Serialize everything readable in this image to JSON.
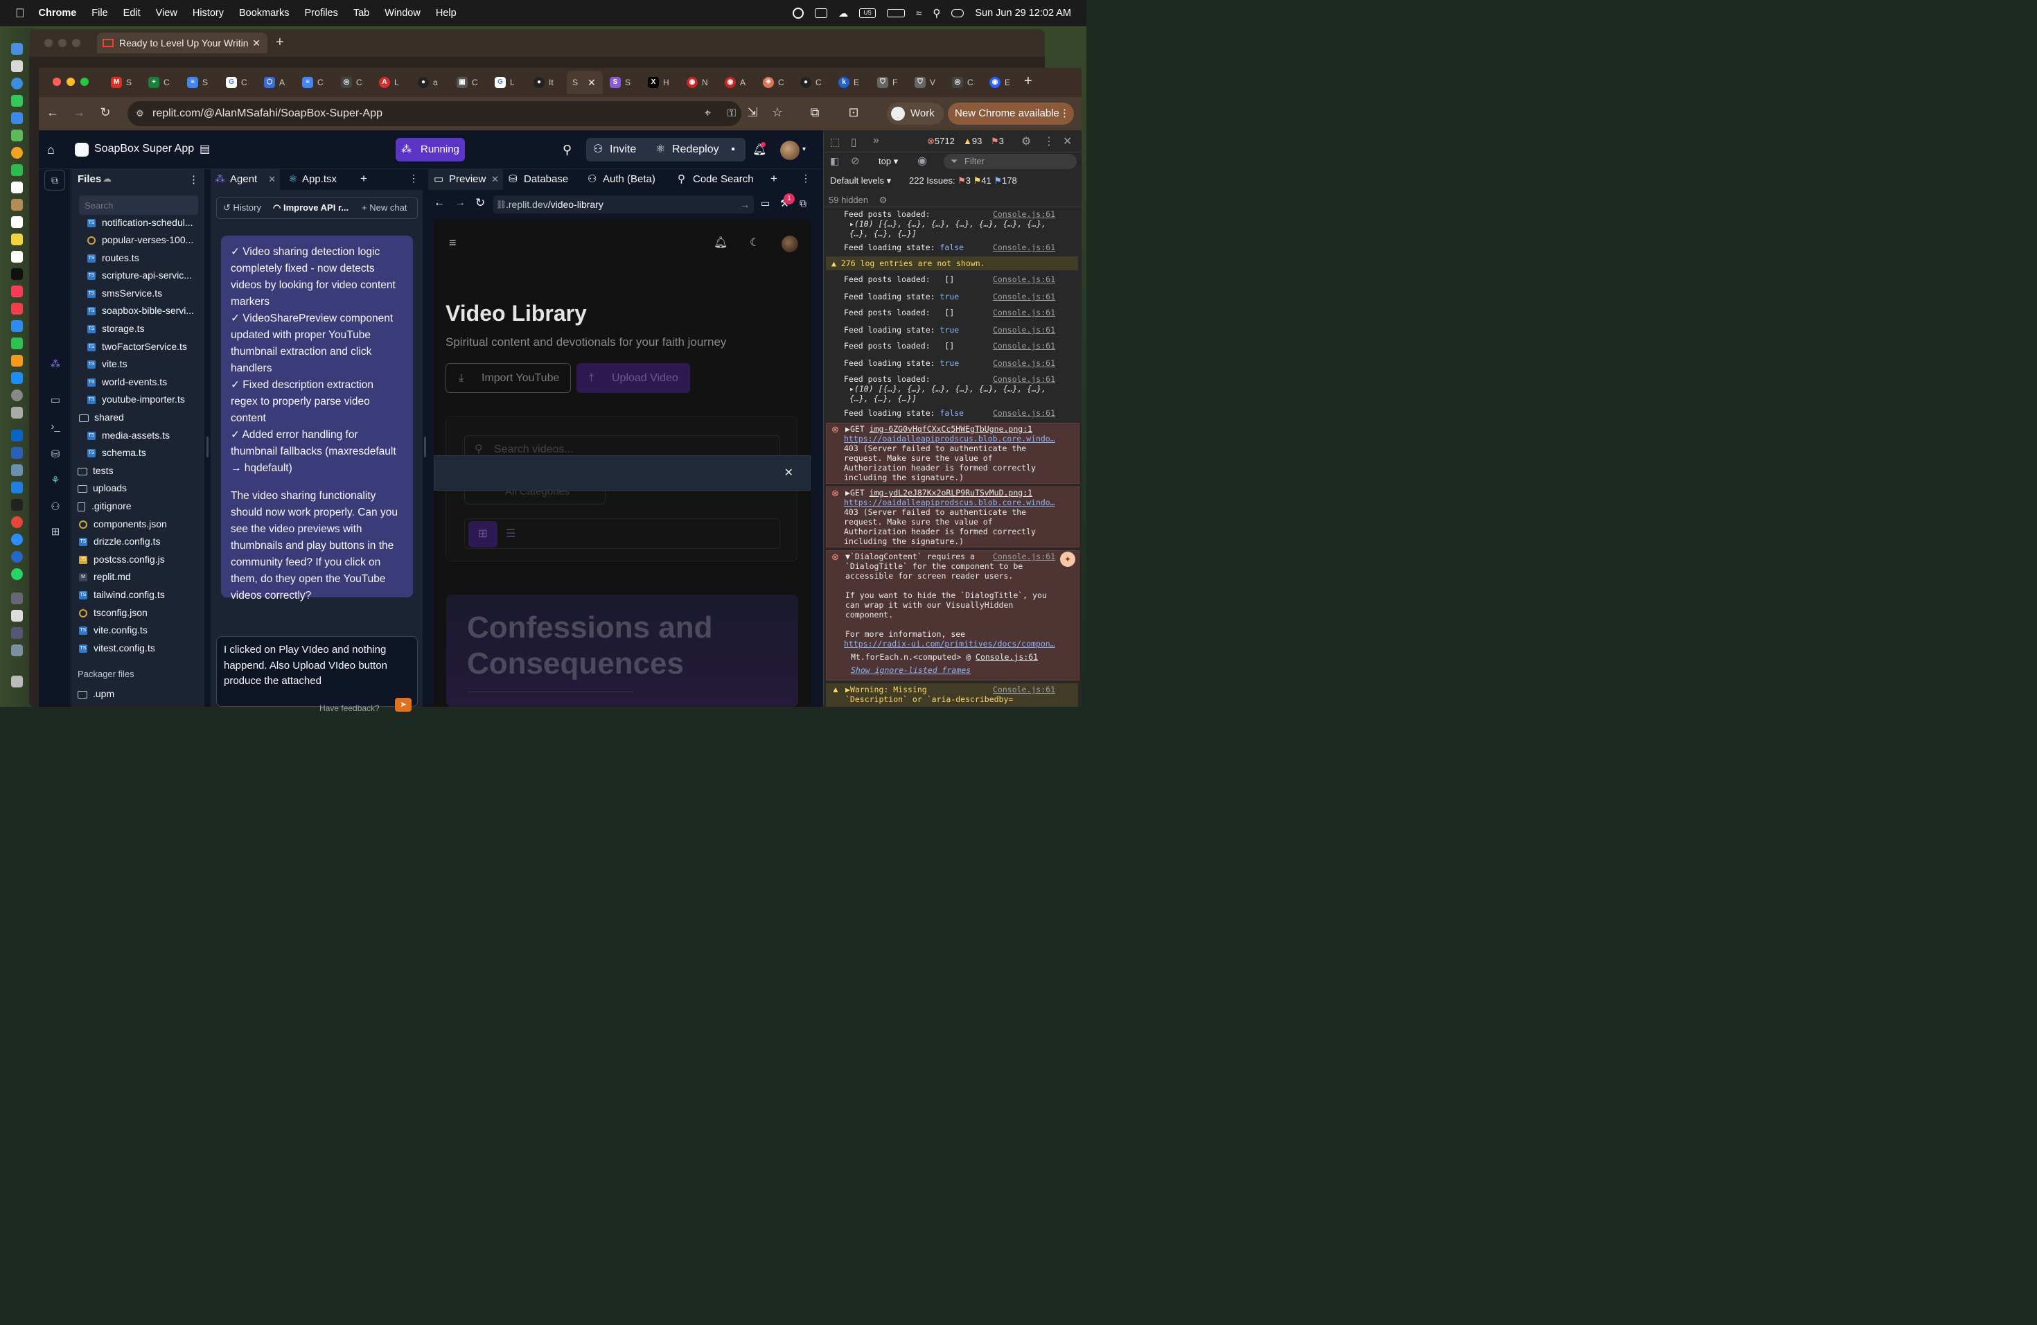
{
  "menubar": {
    "app": "Chrome",
    "items": [
      "File",
      "Edit",
      "View",
      "History",
      "Bookmarks",
      "Profiles",
      "Tab",
      "Window",
      "Help"
    ],
    "datetime": "Sun Jun 29  12:02 AM",
    "input_source": "US"
  },
  "background_window": {
    "tab_title": "Ready to Level Up Your Writin"
  },
  "browser": {
    "tabs": [
      "S",
      "C",
      "S",
      "C",
      "A",
      "C",
      "C",
      "L",
      "a",
      "C",
      "L",
      "It",
      "S",
      "S",
      "H",
      "N",
      "A",
      "C",
      "C",
      "E",
      "F",
      "V",
      "C",
      "E"
    ],
    "url": "replit.com/@AlanMSafahi/SoapBox-Super-App",
    "profile_label": "Work",
    "update_label": "New Chrome available"
  },
  "replit": {
    "app_name": "SoapBox Super App",
    "status": "Running",
    "invite": "Invite",
    "redeploy": "Redeploy",
    "notif_count": "1",
    "files_title": "Files",
    "search_placeholder": "Search",
    "files": [
      {
        "name": "notification-schedul...",
        "type": "ts"
      },
      {
        "name": "popular-verses-100...",
        "type": "json"
      },
      {
        "name": "routes.ts",
        "type": "ts"
      },
      {
        "name": "scripture-api-servic...",
        "type": "ts"
      },
      {
        "name": "smsService.ts",
        "type": "ts"
      },
      {
        "name": "soapbox-bible-servi...",
        "type": "ts"
      },
      {
        "name": "storage.ts",
        "type": "ts"
      },
      {
        "name": "twoFactorService.ts",
        "type": "ts"
      },
      {
        "name": "vite.ts",
        "type": "ts"
      },
      {
        "name": "world-events.ts",
        "type": "ts"
      },
      {
        "name": "youtube-importer.ts",
        "type": "ts"
      },
      {
        "name": "shared",
        "type": "folder"
      },
      {
        "name": "media-assets.ts",
        "type": "ts"
      },
      {
        "name": "schema.ts",
        "type": "ts"
      },
      {
        "name": "tests",
        "type": "folder-root"
      },
      {
        "name": "uploads",
        "type": "folder-root"
      },
      {
        "name": ".gitignore",
        "type": "plain"
      },
      {
        "name": "components.json",
        "type": "json-root"
      },
      {
        "name": "drizzle.config.ts",
        "type": "ts-root"
      },
      {
        "name": "postcss.config.js",
        "type": "js-root"
      },
      {
        "name": "replit.md",
        "type": "md-root"
      },
      {
        "name": "tailwind.config.ts",
        "type": "ts-root"
      },
      {
        "name": "tsconfig.json",
        "type": "json-root"
      },
      {
        "name": "vite.config.ts",
        "type": "ts-root"
      },
      {
        "name": "vitest.config.ts",
        "type": "ts-root"
      }
    ],
    "packager_title": "Packager files",
    "packager_items": [
      ".upm"
    ],
    "agent_tabs": [
      "Agent",
      "App.tsx"
    ],
    "agent_toolbar": {
      "history": "History",
      "thread": "Improve API r...",
      "new_chat": "New chat"
    },
    "agent_message": [
      "✓ Video sharing detection logic completely fixed - now detects videos by looking for video content markers\n✓ VideoSharePreview component updated with proper YouTube thumbnail extraction and click handlers\n✓ Fixed description extraction regex to properly parse video content\n✓ Added error handling for thumbnail fallbacks (maxresdefault → hqdefault)",
      "The video sharing functionality should now work properly. Can you see the video previews with thumbnails and play buttons in the community feed? If you click on them, do they open the YouTube videos correctly?"
    ],
    "chat_input": "I clicked on Play VIdeo and nothing happend. Also Upload VIdeo button produce the attached",
    "chat_footer": "Have feedback?",
    "preview_tabs": [
      "Preview",
      "Database",
      "Auth (Beta)",
      "Code Search"
    ],
    "preview_url_prefix": ".replit.dev",
    "preview_url_path": "/video-library",
    "preview": {
      "title": "Video Library",
      "subtitle": "Spiritual content and devotionals for your faith journey",
      "import_btn": "Import YouTube",
      "upload_btn": "Upload Video",
      "search_placeholder": "Search videos...",
      "category": "All Categories",
      "card_title": "Confessions and Consequences"
    }
  },
  "devtools": {
    "errors": "5712",
    "warnings": "93",
    "infos": "3",
    "context": "top",
    "filter_placeholder": "Filter",
    "levels": "Default levels",
    "issues_label": "222 Issues:",
    "issues_err": "3",
    "issues_warn": "41",
    "issues_info": "178",
    "hidden": "59 hidden",
    "source": "Console.js:61",
    "log": [
      {
        "kind": "log",
        "text": "Feed posts loaded:",
        "src": "Console.js:61"
      },
      {
        "kind": "sub",
        "text": "(10) [{…}, {…}, {…}, {…}, {…}, {…}, {…},\n{…}, {…}, {…}]"
      },
      {
        "kind": "log",
        "text": "Feed loading state: false",
        "src": "Console.js:61"
      },
      {
        "kind": "warn",
        "text": "276 log entries are not shown."
      },
      {
        "kind": "log",
        "text": "Feed posts loaded:   []",
        "src": "Console.js:61"
      },
      {
        "kind": "log",
        "text": "Feed loading state: true",
        "src": "Console.js:61"
      },
      {
        "kind": "log",
        "text": "Feed posts loaded:   []",
        "src": "Console.js:61"
      },
      {
        "kind": "log",
        "text": "Feed loading state: true",
        "src": "Console.js:61"
      },
      {
        "kind": "log",
        "text": "Feed posts loaded:   []",
        "src": "Console.js:61"
      },
      {
        "kind": "log",
        "text": "Feed loading state: true",
        "src": "Console.js:61"
      },
      {
        "kind": "log",
        "text": "Feed posts loaded:",
        "src": "Console.js:61"
      },
      {
        "kind": "sub",
        "text": "(10) [{…}, {…}, {…}, {…}, {…}, {…}, {…},\n{…}, {…}, {…}]"
      },
      {
        "kind": "log",
        "text": "Feed loading state: false",
        "src": "Console.js:61"
      }
    ],
    "err1_head": "GET ",
    "err1_file": "img-6ZG0vHqfCXxCc5HWEgTbUgne.png:1",
    "err1_url": "https://oaidalleapiprodscus.blob.core.windo…",
    "err_body": "403 (Server failed to authenticate the\nrequest. Make sure the value of\nAuthorization header is formed correctly\nincluding the signature.)",
    "err2_file": "img-ydL2eJ87Kx2oRLP9RuTSvMuD.png:1",
    "err3_head": "`DialogContent` requires a\n`DialogTitle` for the component to be\naccessible for screen reader users.\n\nIf you want to hide the `DialogTitle`, you\ncan wrap it with our VisuallyHidden\ncomponent.\n\nFor more information, see",
    "err3_link": "https://radix-ui.com/primitives/docs/compon…",
    "err3_stack": "Mt.forEach.n.<computed> @ ",
    "err3_more": "Show ignore-listed frames",
    "warn_text": "Warning: Missing\n`Description` or `aria-describedby="
  }
}
